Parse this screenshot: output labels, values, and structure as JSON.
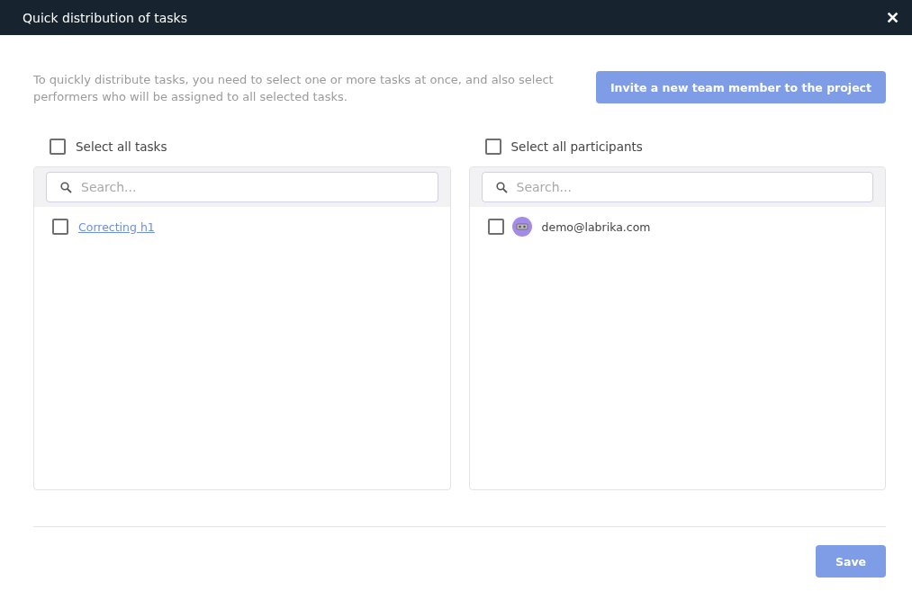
{
  "window": {
    "title": "Quick distribution of tasks",
    "close": "✕"
  },
  "description": "To quickly distribute tasks, you need to select one or more tasks at once, and also select performers who will be assigned to all selected tasks.",
  "invite_button": "Invite a new team member to the project",
  "panels": [
    {
      "select_all": {
        "label": "Select all tasks",
        "checked": false
      },
      "search": {
        "placeholder": "Search..."
      },
      "items": [
        {
          "kind": "task",
          "label": "Correcting h1",
          "checked": false
        }
      ]
    },
    {
      "select_all": {
        "label": "Select all participants",
        "checked": false
      },
      "search": {
        "placeholder": "Search..."
      },
      "items": [
        {
          "kind": "user",
          "label": "demo@labrika.com",
          "checked": false
        }
      ]
    }
  ],
  "save_button": "Save"
}
